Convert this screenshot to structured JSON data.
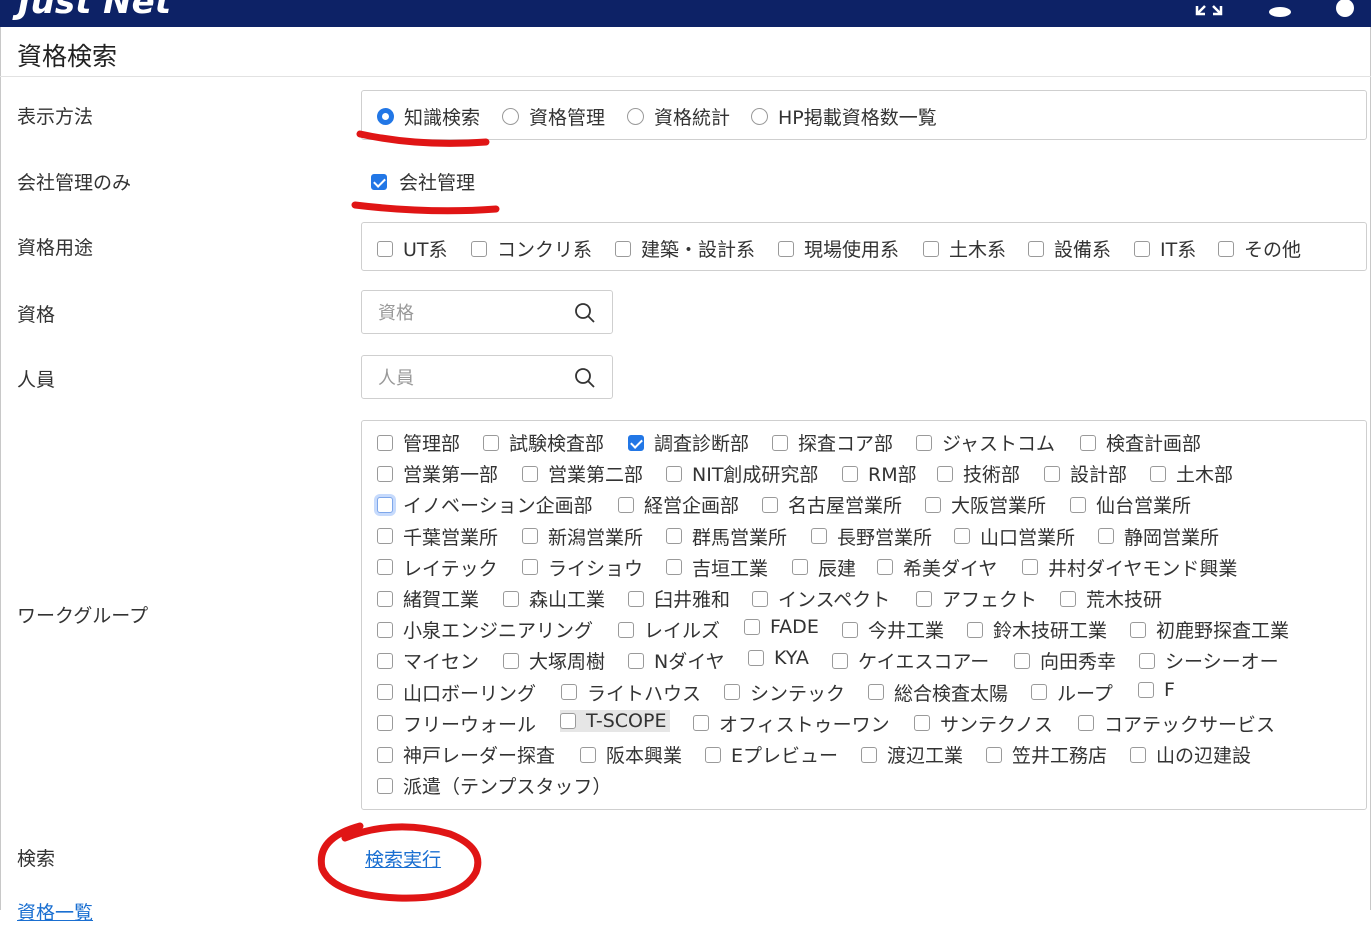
{
  "header": {
    "logo_text": "Just Net",
    "colors": {
      "bar": "#0d2266",
      "text": "#ffffff"
    },
    "icons": [
      "expand-icon",
      "user-icon",
      "settings-icon"
    ]
  },
  "page": {
    "title": "資格検索"
  },
  "display_method": {
    "label": "表示方法",
    "options": [
      "知識検索",
      "資格管理",
      "資格統計",
      "HP掲載資格数一覧"
    ],
    "selected": "知識検索"
  },
  "company_only": {
    "label": "会社管理のみ",
    "option": "会社管理",
    "checked": true
  },
  "usage": {
    "label": "資格用途",
    "options": [
      "UT系",
      "コンクリ系",
      "建築・設計系",
      "現場使用系",
      "土木系",
      "設備系",
      "IT系",
      "その他"
    ]
  },
  "qualification": {
    "label": "資格",
    "placeholder": "資格"
  },
  "personnel": {
    "label": "人員",
    "placeholder": "人員"
  },
  "workgroup": {
    "label": "ワークグループ",
    "rows": [
      [
        "管理部",
        "試験検査部",
        "調査診断部",
        "探査コア部",
        "ジャストコム",
        "検査計画部"
      ],
      [
        "営業第一部",
        "営業第二部",
        "NIT創成研究部",
        "RM部",
        "技術部",
        "設計部",
        "土木部"
      ],
      [
        "イノベーション企画部",
        "経営企画部",
        "名古屋営業所",
        "大阪営業所",
        "仙台営業所"
      ],
      [
        "千葉営業所",
        "新潟営業所",
        "群馬営業所",
        "長野営業所",
        "山口営業所",
        "静岡営業所"
      ],
      [
        "レイテック",
        "ライショウ",
        "吉垣工業",
        "辰建",
        "希美ダイヤ",
        "井村ダイヤモンド興業"
      ],
      [
        "緒賀工業",
        "森山工業",
        "臼井雅和",
        "インスペクト",
        "アフェクト",
        "荒木技研"
      ],
      [
        "小泉エンジニアリング",
        "レイルズ",
        "FADE",
        "今井工業",
        "鈴木技研工業",
        "初鹿野探査工業"
      ],
      [
        "マイセン",
        "大塚周樹",
        "Nダイヤ",
        "KYA",
        "ケイエスコアー",
        "向田秀幸",
        "シーシーオー"
      ],
      [
        "山口ボーリング",
        "ライトハウス",
        "シンテック",
        "総合検査太陽",
        "ループ",
        "F"
      ],
      [
        "フリーウォール",
        "T-SCOPE",
        "オフィストゥーワン",
        "サンテクノス",
        "コアテックサービス"
      ],
      [
        "神戸レーダー探査",
        "阪本興業",
        "Eプレビュー",
        "渡辺工業",
        "笠井工務店",
        "山の辺建設"
      ],
      [
        "派遣（テンプスタッフ）"
      ]
    ],
    "checked": [
      "調査診断部"
    ],
    "focused": "イノベーション企画部",
    "highlighted": "T-SCOPE"
  },
  "search": {
    "label": "検索",
    "run_link": "検索実行"
  },
  "bottom": {
    "link_partial": "資格一覧"
  },
  "colors": {
    "accent": "#2277e6",
    "link": "#1a6fd1",
    "annotation": "#e01515"
  }
}
